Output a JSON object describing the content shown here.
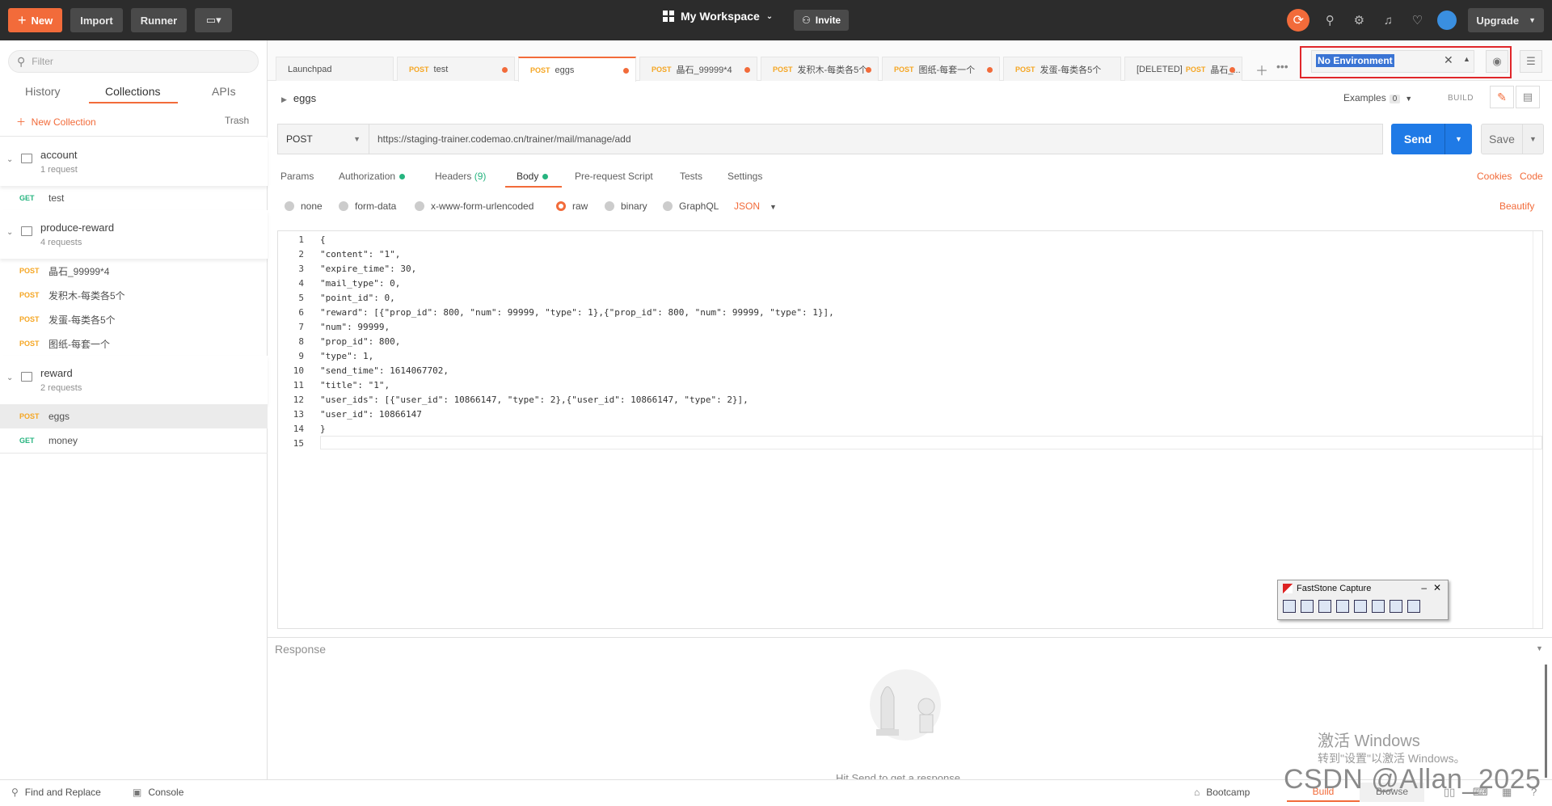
{
  "topbar": {
    "new_label": "New",
    "import_label": "Import",
    "runner_label": "Runner",
    "workspace_label": "My Workspace",
    "invite_label": "Invite",
    "upgrade_label": "Upgrade"
  },
  "sidebar": {
    "filter_placeholder": "Filter",
    "tabs": [
      "History",
      "Collections",
      "APIs"
    ],
    "active_tab": "Collections",
    "new_collection_label": "New Collection",
    "trash_label": "Trash",
    "collections": [
      {
        "name": "account",
        "count": "1 request",
        "requests": [
          {
            "method": "GET",
            "name": "test"
          }
        ]
      },
      {
        "name": "produce-reward",
        "count": "4 requests",
        "requests": [
          {
            "method": "POST",
            "name": "晶石_99999*4"
          },
          {
            "method": "POST",
            "name": "发积木-每类各5个"
          },
          {
            "method": "POST",
            "name": "发蛋-每类各5个"
          },
          {
            "method": "POST",
            "name": "图纸-每套一个"
          }
        ]
      },
      {
        "name": "reward",
        "count": "2 requests",
        "requests": [
          {
            "method": "POST",
            "name": "eggs"
          },
          {
            "method": "GET",
            "name": "money"
          }
        ]
      }
    ]
  },
  "tabs": [
    {
      "method": "",
      "name": "Launchpad"
    },
    {
      "method": "POST",
      "name": "test"
    },
    {
      "method": "POST",
      "name": "eggs"
    },
    {
      "method": "POST",
      "name": "晶石_99999*4"
    },
    {
      "method": "POST",
      "name": "发积木-每类各5个"
    },
    {
      "method": "POST",
      "name": "图纸-每套一个"
    },
    {
      "method": "POST",
      "name": "发蛋-每类各5个"
    },
    {
      "prefix": "[DELETED]",
      "method": "POST",
      "name": "晶石_..."
    }
  ],
  "environment": {
    "selected": "No Environment"
  },
  "request": {
    "name": "eggs",
    "examples_label": "Examples",
    "examples_count": "0",
    "build_label": "BUILD",
    "method": "POST",
    "url": "https://staging-trainer.codemao.cn/trainer/mail/manage/add",
    "send_label": "Send",
    "save_label": "Save",
    "subtabs": {
      "params": "Params",
      "authorization": "Authorization",
      "headers": "Headers",
      "headers_count": "(9)",
      "body": "Body",
      "prerequest": "Pre-request Script",
      "tests": "Tests",
      "settings": "Settings"
    },
    "cookies_label": "Cookies",
    "code_label": "Code",
    "body_modes": {
      "none": "none",
      "form_data": "form-data",
      "urlencoded": "x-www-form-urlencoded",
      "raw": "raw",
      "binary": "binary",
      "graphql": "GraphQL"
    },
    "body_format": "JSON",
    "beautify_label": "Beautify",
    "body_lines": [
      "{",
      "\"content\": \"1\",",
      "\"expire_time\": 30,",
      "\"mail_type\": 0,",
      "\"point_id\": 0,",
      "\"reward\": [{\"prop_id\": 800, \"num\": 99999, \"type\": 1},{\"prop_id\": 800, \"num\": 99999, \"type\": 1}],",
      "\"num\": 99999,",
      "\"prop_id\": 800,",
      "\"type\": 1,",
      "\"send_time\": 1614067702,",
      "\"title\": \"1\",",
      "\"user_ids\": [{\"user_id\": 10866147, \"type\": 2},{\"user_id\": 10866147, \"type\": 2}],",
      "\"user_id\": 10866147",
      "}",
      ""
    ],
    "line_numbers": [
      "1",
      "2",
      "3",
      "4",
      "5",
      "6",
      "7",
      "8",
      "9",
      "10",
      "11",
      "12",
      "13",
      "14",
      "15"
    ]
  },
  "faststone": {
    "title": "FastStone Capture"
  },
  "response": {
    "label": "Response",
    "hint": "Hit Send to get a response"
  },
  "watermarks": {
    "activate_title": "激活 Windows",
    "activate_sub": "转到\"设置\"以激活 Windows。",
    "csdn": "CSDN @Allan_2025"
  },
  "statusbar": {
    "find_replace": "Find and Replace",
    "console": "Console",
    "bootcamp": "Bootcamp",
    "build": "Build",
    "browse": "Browse"
  }
}
